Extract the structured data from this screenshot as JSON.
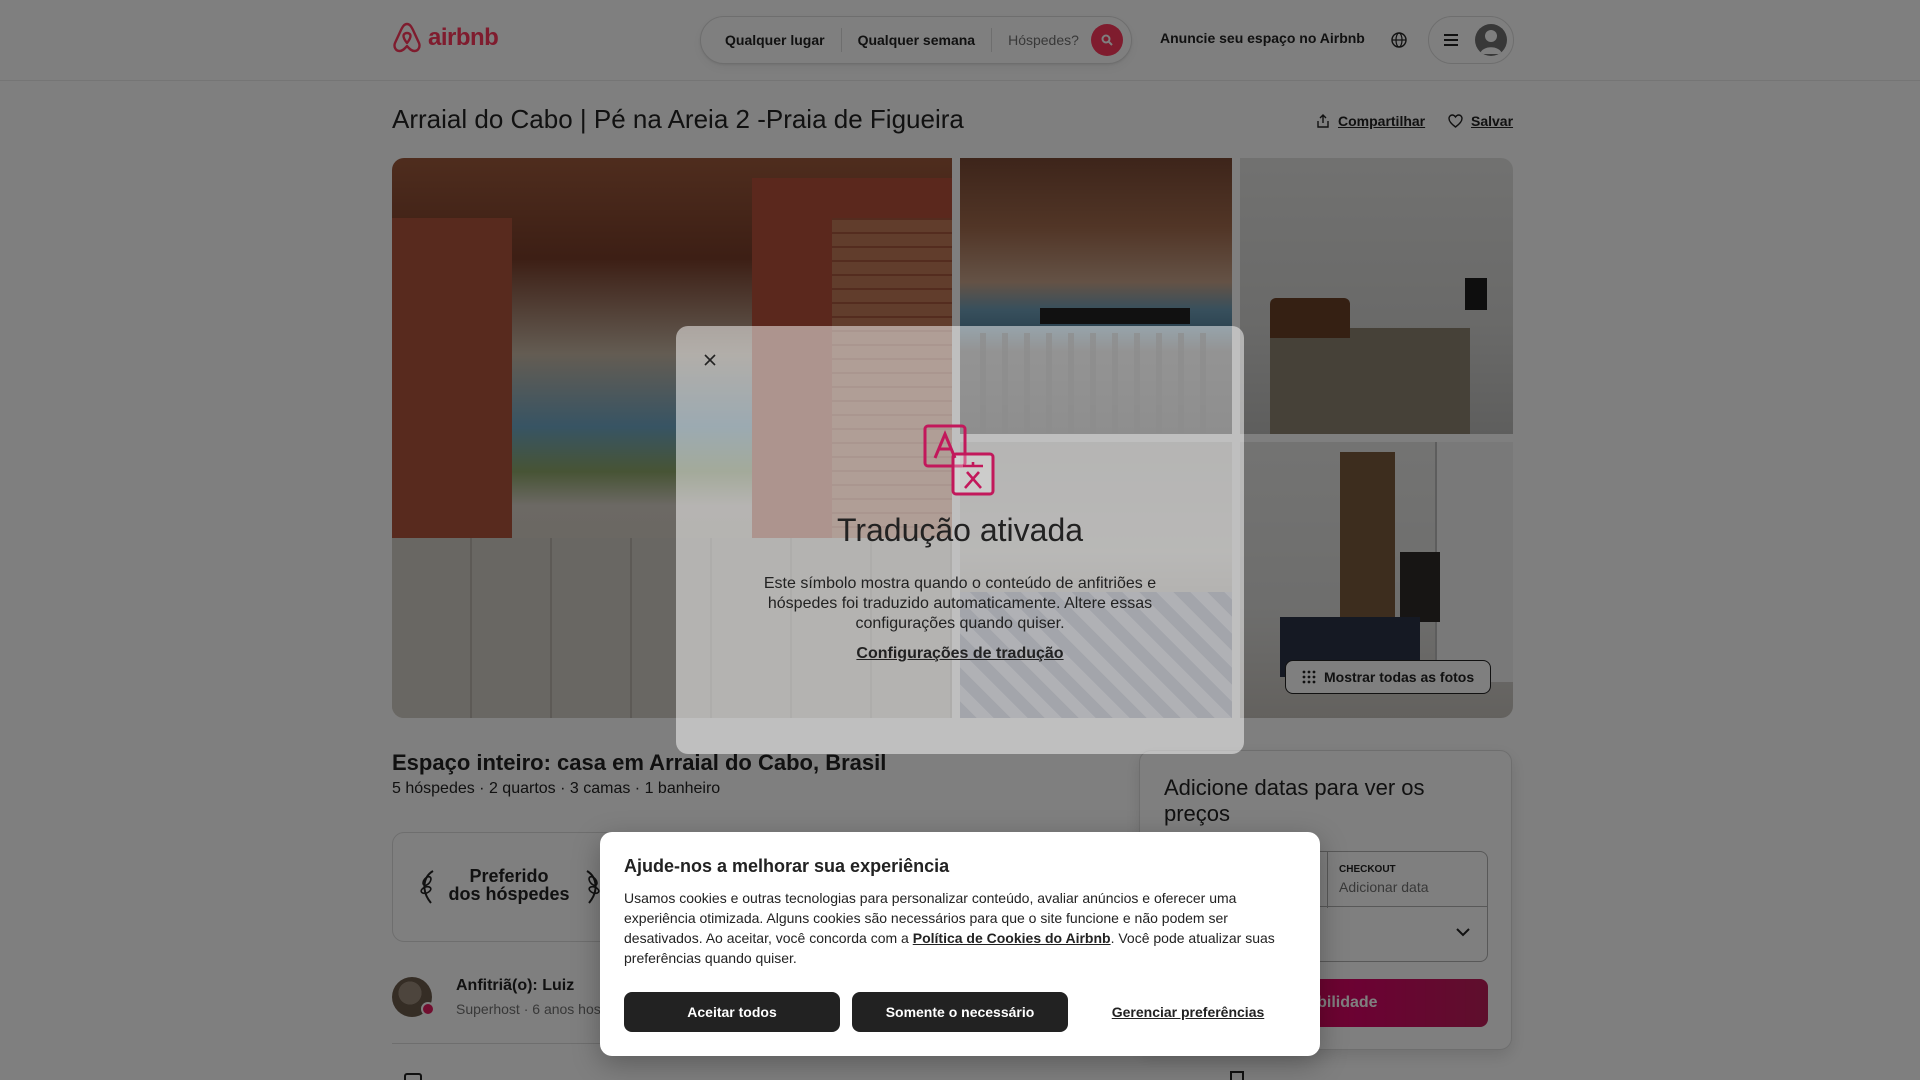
{
  "header": {
    "logo_text": "airbnb",
    "search": {
      "place": "Qualquer lugar",
      "week": "Qualquer semana",
      "guests": "Hóspedes?"
    },
    "host_link": "Anuncie seu espaço no Airbnb",
    "brand_color": "#FF385C"
  },
  "listing": {
    "title": "Arraial do Cabo | Pé na Areia 2 -Praia de Figueira",
    "share_label": "Compartilhar",
    "save_label": "Salvar",
    "show_all_photos": "Mostrar todas as fotos",
    "space_title": "Espaço inteiro: casa em Arraial do Cabo, Brasil",
    "space_summary": "5 hóspedes · 2 quartos · 3 camas · 1 banheiro",
    "guest_favorite_line1": "Preferido",
    "guest_favorite_line2": "dos hóspedes",
    "host_name": "Anfitriã(o): Luiz",
    "host_sub": "Superhost · 6 anos hos"
  },
  "booking": {
    "title": "Adicione datas para ver os preços",
    "checkout_label": "CHECKOUT",
    "checkout_value": "Adicionar data",
    "availability_button": "sponibilidade"
  },
  "translation_modal": {
    "title": "Tradução ativada",
    "text": "Este símbolo mostra quando o conteúdo de anfitriões e hóspedes foi traduzido automaticamente. Altere essas configurações quando quiser.",
    "link": "Configurações de tradução"
  },
  "cookie_banner": {
    "title": "Ajude-nos a melhorar sua experiência",
    "text_before_link": "Usamos cookies e outras tecnologias para personalizar conteúdo, avaliar anúncios e oferecer uma experiência otimizada. Alguns cookies são necessários para que o site funcione e não podem ser desativados. Ao aceitar, você concorda com a ",
    "link": "Política de Cookies do Airbnb",
    "text_after_link": ". Você pode atualizar suas preferências quando quiser.",
    "accept_all": "Aceitar todos",
    "only_necessary": "Somente o necessário",
    "manage_preferences": "Gerenciar preferências"
  }
}
